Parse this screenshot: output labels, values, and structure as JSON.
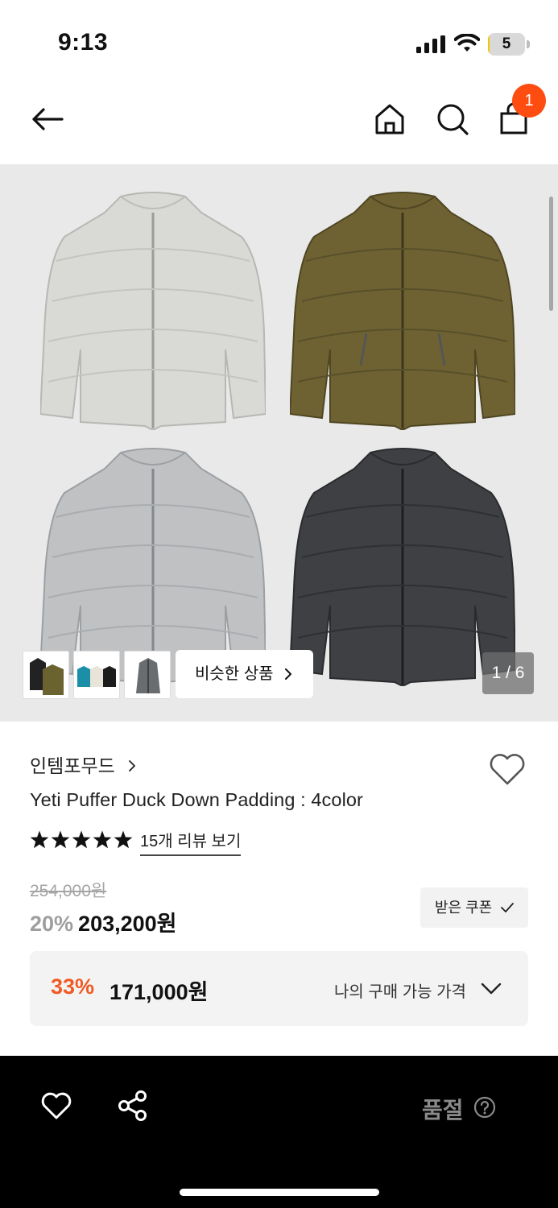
{
  "status_bar": {
    "time": "9:13",
    "battery_level": "5",
    "battery_color": "#f5c500"
  },
  "nav": {
    "back_icon": "arrow-left-icon",
    "home_icon": "home-icon",
    "search_icon": "search-icon",
    "cart_icon": "shopping-bag-icon",
    "cart_count": "1",
    "badge_color": "#ff4d12"
  },
  "gallery": {
    "thumbnails": [
      "thumb-black-olive",
      "thumb-teal-cream-black",
      "thumb-grey"
    ],
    "similar_label": "비슷한 상품",
    "page_indicator": "1 / 6"
  },
  "product": {
    "brand": "인템포무드",
    "name": "Yeti Puffer Duck Down Padding : 4color",
    "rating_stars": 5,
    "review_link": "15개 리뷰 보기",
    "original_price": "254,000원",
    "discount_rate": "20%",
    "sale_price": "203,200원",
    "coupon_label": "받은 쿠폰"
  },
  "my_price": {
    "rate": "33%",
    "price": "171,000원",
    "label": "나의 구매 가능 가격",
    "accent_color": "#f05a24"
  },
  "bottom_bar": {
    "wish_icon": "heart-icon",
    "share_icon": "share-icon",
    "status_label": "품절",
    "help_icon": "question-circle-icon"
  }
}
